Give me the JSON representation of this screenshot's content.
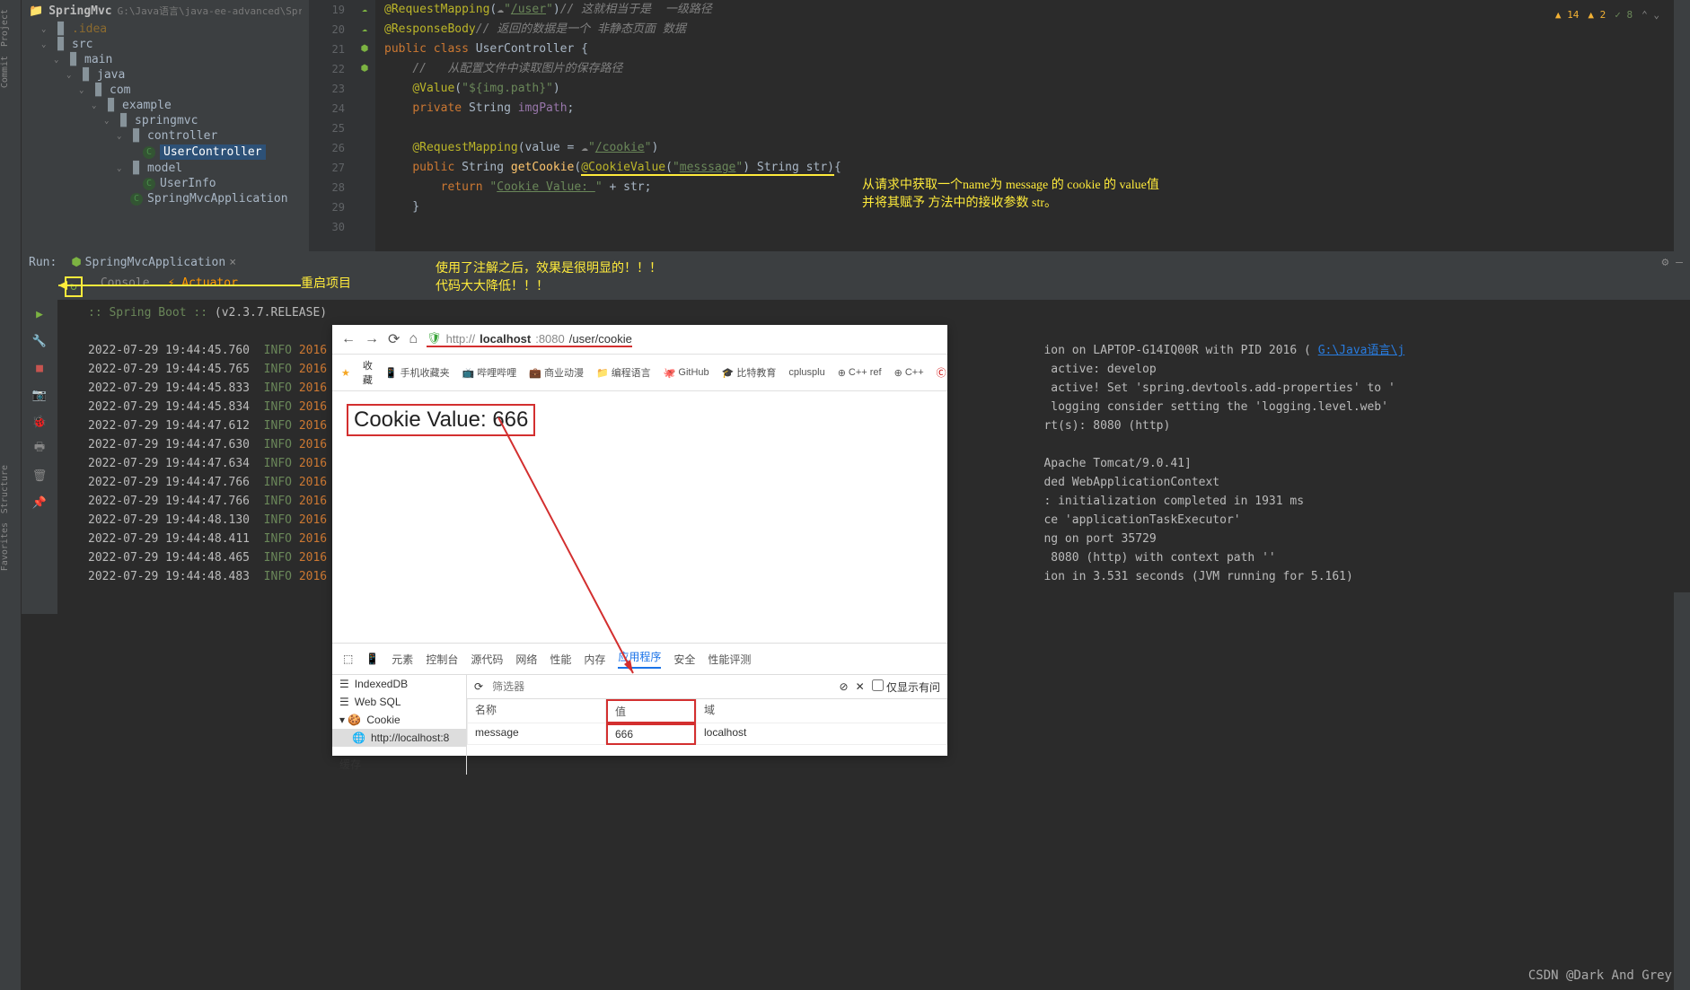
{
  "left_tabs": [
    "Project",
    "Commit"
  ],
  "left_lower_tabs": [
    "Structure",
    "Favorites"
  ],
  "project": {
    "name": "SpringMvc",
    "path": "G:\\Java语言\\java-ee-advanced\\SpringM",
    "tree": [
      {
        "indent": 1,
        "arrow": "⌄",
        "icon": "folder",
        "label": ".idea",
        "muted": true
      },
      {
        "indent": 1,
        "arrow": "⌄",
        "icon": "folder",
        "label": "src"
      },
      {
        "indent": 2,
        "arrow": "⌄",
        "icon": "folder",
        "label": "main"
      },
      {
        "indent": 3,
        "arrow": "⌄",
        "icon": "folder",
        "label": "java"
      },
      {
        "indent": 4,
        "arrow": "⌄",
        "icon": "folder",
        "label": "com"
      },
      {
        "indent": 5,
        "arrow": "⌄",
        "icon": "folder",
        "label": "example"
      },
      {
        "indent": 6,
        "arrow": "⌄",
        "icon": "folder",
        "label": "springmvc"
      },
      {
        "indent": 7,
        "arrow": "⌄",
        "icon": "folder",
        "label": "controller"
      },
      {
        "indent": 8,
        "arrow": "",
        "icon": "class",
        "label": "UserController",
        "selected": true
      },
      {
        "indent": 7,
        "arrow": "⌄",
        "icon": "folder",
        "label": "model"
      },
      {
        "indent": 8,
        "arrow": "",
        "icon": "class",
        "label": "UserInfo"
      },
      {
        "indent": 7,
        "arrow": "",
        "icon": "class",
        "label": "SpringMvcApplication"
      }
    ]
  },
  "editor": {
    "lines_start": 19,
    "lines_end": 30,
    "status": {
      "warn": "14",
      "warn2": "2",
      "ok": "8"
    },
    "code": {
      "request_mapping": "/user",
      "rm_comment": "// 这就相当于是  一级路径",
      "rb_comment": "// 返回的数据是一个 非静态页面 数据",
      "class_name": "UserController",
      "cfg_comment": "从配置文件中读取图片的保存路径",
      "value_expr": "${img.path}",
      "field": "imgPath",
      "cookie_path": "/cookie",
      "method": "getCookie",
      "cookie_name": "messsage",
      "param": "str",
      "ret_prefix": "Cookie Value: "
    }
  },
  "annotations": {
    "side1": "从请求中获取一个name为 message 的 cookie 的 value值",
    "side2": "并将其赋予 方法中的接收参数 str。",
    "restart": "重启项目",
    "below1": "使用了注解之后，效果是很明显的！！！",
    "below2": "代码大大降低！！！"
  },
  "run": {
    "title": "Run:",
    "app": "SpringMvcApplication",
    "sub_tabs": [
      "Console",
      "Actuator"
    ],
    "banner": ":: Spring Boot ::",
    "version": "(v2.3.7.RELEASE)",
    "logs": [
      {
        "ts": "2022-07-29 19:44:45.760",
        "lvl": "INFO",
        "pid": "2016",
        "msg": "ion on LAPTOP-G14IQ00R with PID 2016 (",
        "link": "G:\\Java语言\\j"
      },
      {
        "ts": "2022-07-29 19:44:45.765",
        "lvl": "INFO",
        "pid": "2016",
        "msg": " active: develop"
      },
      {
        "ts": "2022-07-29 19:44:45.833",
        "lvl": "INFO",
        "pid": "2016",
        "msg": " active! Set 'spring.devtools.add-properties' to '"
      },
      {
        "ts": "2022-07-29 19:44:45.834",
        "lvl": "INFO",
        "pid": "2016",
        "msg": " logging consider setting the 'logging.level.web'"
      },
      {
        "ts": "2022-07-29 19:44:47.612",
        "lvl": "INFO",
        "pid": "2016",
        "msg": "rt(s): 8080 (http)"
      },
      {
        "ts": "2022-07-29 19:44:47.630",
        "lvl": "INFO",
        "pid": "2016",
        "msg": ""
      },
      {
        "ts": "2022-07-29 19:44:47.634",
        "lvl": "INFO",
        "pid": "2016",
        "msg": "Apache Tomcat/9.0.41]"
      },
      {
        "ts": "2022-07-29 19:44:47.766",
        "lvl": "INFO",
        "pid": "2016",
        "msg": "ded WebApplicationContext"
      },
      {
        "ts": "2022-07-29 19:44:47.766",
        "lvl": "INFO",
        "pid": "2016",
        "msg": ": initialization completed in 1931 ms"
      },
      {
        "ts": "2022-07-29 19:44:48.130",
        "lvl": "INFO",
        "pid": "2016",
        "msg": "ce 'applicationTaskExecutor'"
      },
      {
        "ts": "2022-07-29 19:44:48.411",
        "lvl": "INFO",
        "pid": "2016",
        "msg": "ng on port 35729"
      },
      {
        "ts": "2022-07-29 19:44:48.465",
        "lvl": "INFO",
        "pid": "2016",
        "msg": " 8080 (http) with context path ''"
      },
      {
        "ts": "2022-07-29 19:44:48.483",
        "lvl": "INFO",
        "pid": "2016",
        "msg": "ion in 3.531 seconds (JVM running for 5.161)"
      }
    ]
  },
  "browser": {
    "url_host": "localhost",
    "url_port": ":8080",
    "url_path": "/user/cookie",
    "url_prefix": "http://",
    "bookmarks_label": "收藏",
    "bookmarks": [
      "手机收藏夹",
      "哔哩哔哩",
      "商业动漫",
      "编程语言",
      "GitHub",
      "比特教育",
      "cplusplu",
      "C++ ref",
      "C++",
      "CSDN博"
    ],
    "content": "Cookie Value: 666",
    "devtools": {
      "tabs": [
        "元素",
        "控制台",
        "源代码",
        "网络",
        "性能",
        "内存",
        "应用程序",
        "安全",
        "性能评测"
      ],
      "active_tab": "应用程序",
      "side_items": [
        "IndexedDB",
        "Web SQL",
        "Cookie",
        "http://localhost:8"
      ],
      "filter_placeholder": "筛选器",
      "checkbox_label": "仅显示有问",
      "cols": [
        "名称",
        "值",
        "域"
      ],
      "row": {
        "name": "message",
        "value": "666",
        "domain": "localhost"
      },
      "cache_label": "缓存"
    }
  },
  "watermark": "CSDN @Dark And Grey"
}
